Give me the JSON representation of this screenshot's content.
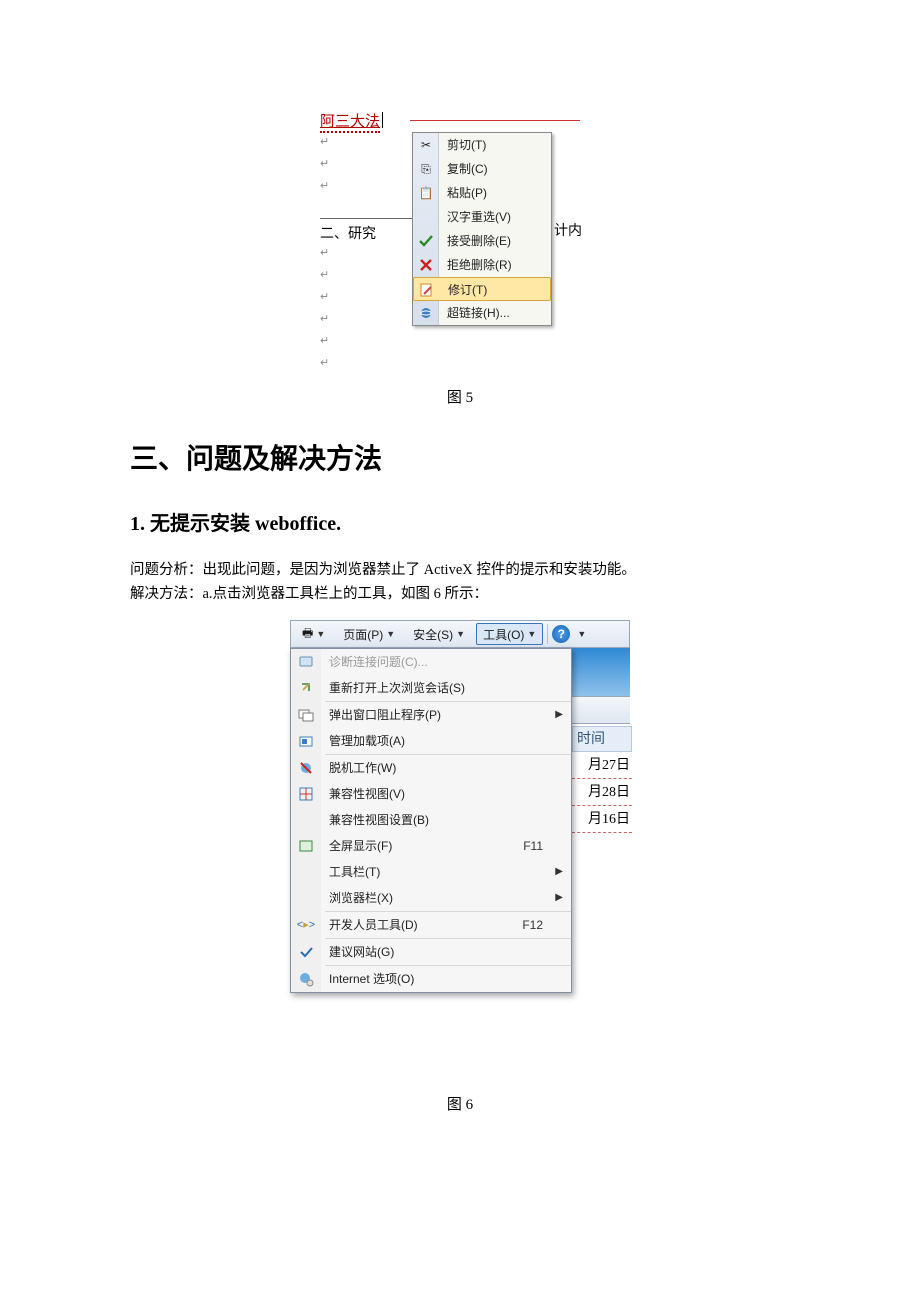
{
  "fig5": {
    "doc_link_text": "阿三大法",
    "heading_left": "二、研究",
    "heading_right": "计内",
    "menu": {
      "cut": "剪切(T)",
      "copy": "复制(C)",
      "paste": "粘贴(P)",
      "ime": "汉字重选(V)",
      "accept": "接受删除(E)",
      "reject": "拒绝删除(R)",
      "revise": "修订(T)",
      "hyperlink": "超链接(H)..."
    },
    "caption": "图 5"
  },
  "heading_section": "三、问题及解决方法",
  "heading_sub": "1. 无提示安装 weboffice.",
  "para1": "问题分析：出现此问题，是因为浏览器禁止了 ActiveX 控件的提示和安装功能。",
  "para2": "解决方法：a.点击浏览器工具栏上的工具，如图 6 所示：",
  "fig6": {
    "toolbar": {
      "print_icon": "🖶",
      "page": "页面(P)",
      "safety": "安全(S)",
      "tools": "工具(O)",
      "help": "?"
    },
    "menu": {
      "diag": "诊断连接问题(C)...",
      "reopen": "重新打开上次浏览会话(S)",
      "popup": "弹出窗口阻止程序(P)",
      "addons": "管理加载项(A)",
      "offline": "脱机工作(W)",
      "compat": "兼容性视图(V)",
      "compat_cfg": "兼容性视图设置(B)",
      "fullscreen": "全屏显示(F)",
      "fullscreen_k": "F11",
      "toolbars": "工具栏(T)",
      "explorer": "浏览器栏(X)",
      "devtools": "开发人员工具(D)",
      "devtools_k": "F12",
      "suggested": "建议网站(G)",
      "inetopt": "Internet 选项(O)"
    },
    "bg_head": "时间",
    "bg_rows": [
      "月27日",
      "月28日",
      "月16日"
    ],
    "caption": "图 6"
  }
}
